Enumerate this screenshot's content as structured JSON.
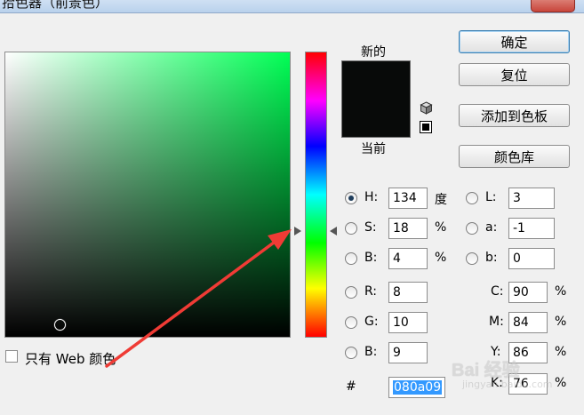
{
  "window": {
    "title": "拾色器（前景色）"
  },
  "swatches": {
    "new_label": "新的",
    "current_label": "当前",
    "new_color": "#080a09",
    "current_color": "#080a09"
  },
  "buttons": {
    "ok": "确定",
    "reset": "复位",
    "add_to_swatches": "添加到色板",
    "color_libraries": "颜色库"
  },
  "hsb": {
    "h": {
      "label": "H:",
      "value": "134",
      "unit": "度",
      "selected": true
    },
    "s": {
      "label": "S:",
      "value": "18",
      "unit": "%"
    },
    "b": {
      "label": "B:",
      "value": "4",
      "unit": "%"
    }
  },
  "rgb": {
    "r": {
      "label": "R:",
      "value": "8"
    },
    "g": {
      "label": "G:",
      "value": "10"
    },
    "b": {
      "label": "B:",
      "value": "9"
    }
  },
  "lab": {
    "l": {
      "label": "L:",
      "value": "3"
    },
    "a": {
      "label": "a:",
      "value": "-1"
    },
    "b": {
      "label": "b:",
      "value": "0"
    }
  },
  "cmyk": {
    "c": {
      "label": "C:",
      "value": "90",
      "unit": "%"
    },
    "m": {
      "label": "M:",
      "value": "84",
      "unit": "%"
    },
    "y": {
      "label": "Y:",
      "value": "86",
      "unit": "%"
    },
    "k": {
      "label": "K:",
      "value": "76",
      "unit": "%"
    }
  },
  "hex": {
    "label": "#",
    "value": "080a09"
  },
  "web_only": {
    "label": "只有 Web 颜色",
    "checked": false
  },
  "picker": {
    "hue_color": "#00ff55"
  },
  "watermark": {
    "brand": "Bai 经验",
    "site": "jingyan.baidu.com"
  },
  "icons": {
    "out_of_gamut": "cube-warning-icon",
    "web_safe": "web-safe-square-icon"
  }
}
